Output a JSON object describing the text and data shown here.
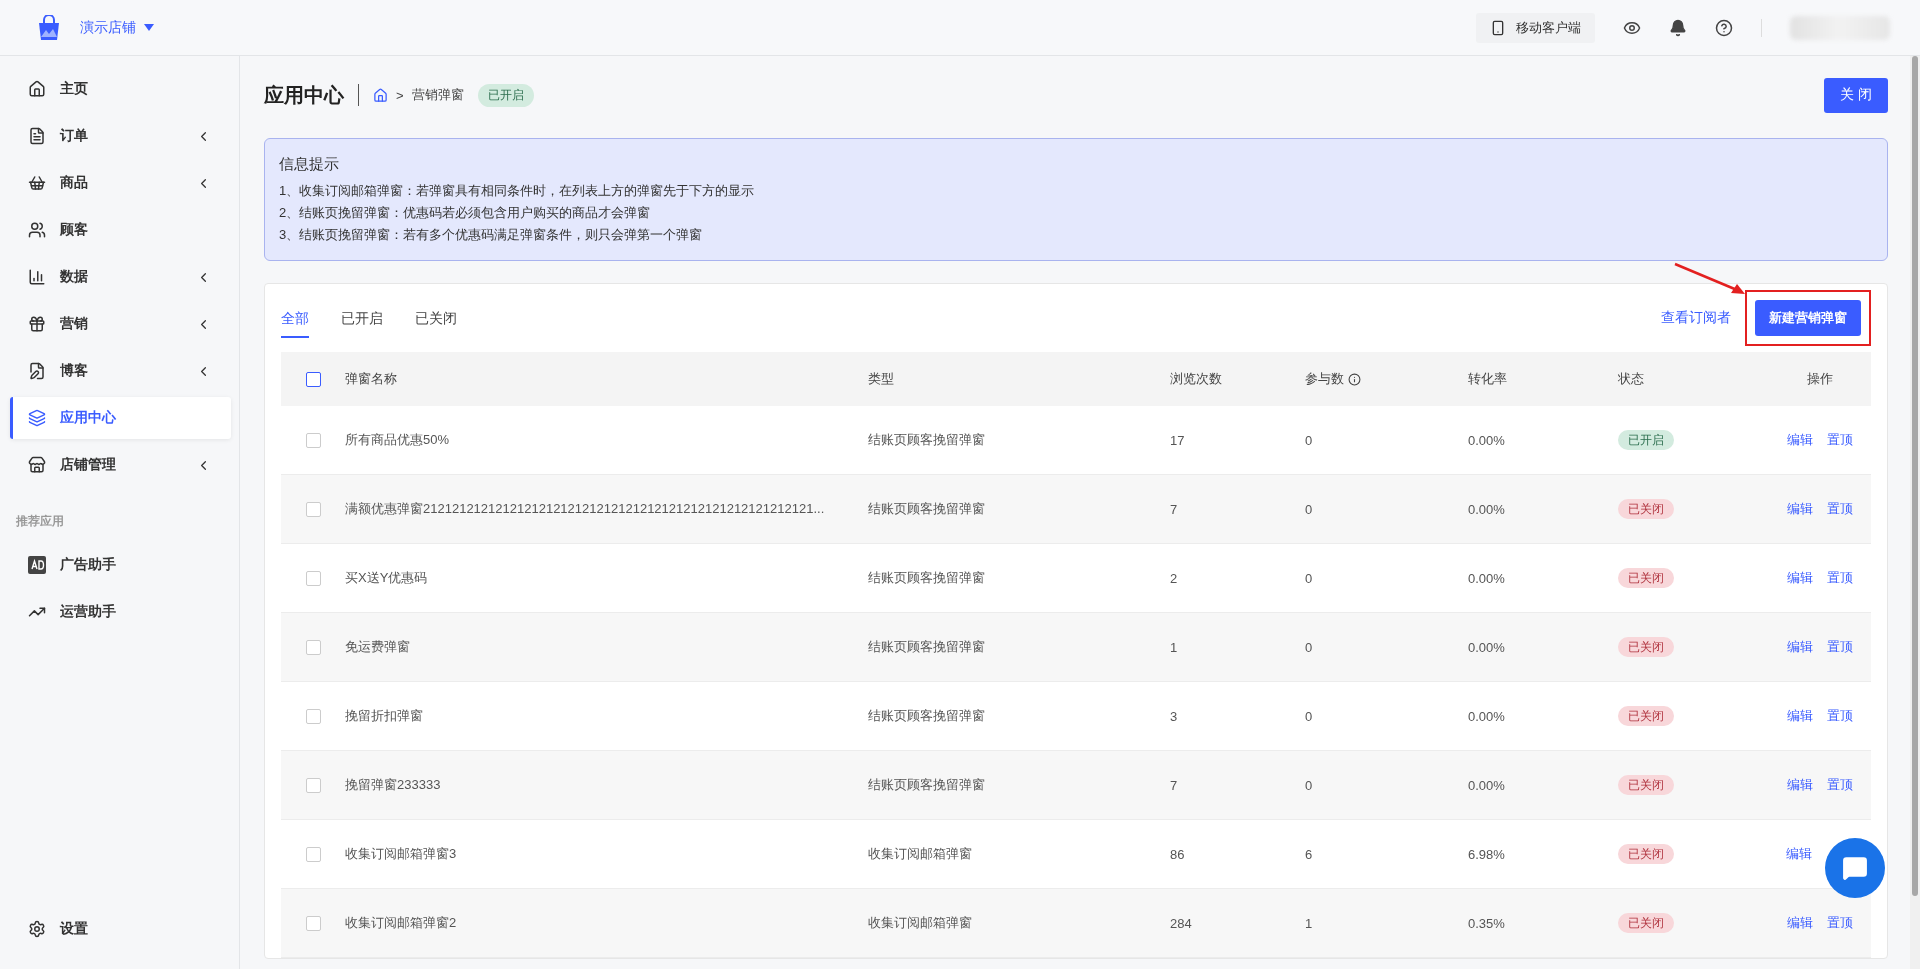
{
  "topbar": {
    "store_name": "演示店铺",
    "mobile_label": "移动客户端"
  },
  "sidebar": {
    "items": [
      {
        "label": "主页",
        "expandable": false,
        "selected": false
      },
      {
        "label": "订单",
        "expandable": true,
        "selected": false
      },
      {
        "label": "商品",
        "expandable": true,
        "selected": false
      },
      {
        "label": "顾客",
        "expandable": false,
        "selected": false
      },
      {
        "label": "数据",
        "expandable": true,
        "selected": false
      },
      {
        "label": "营销",
        "expandable": true,
        "selected": false
      },
      {
        "label": "博客",
        "expandable": true,
        "selected": false
      },
      {
        "label": "应用中心",
        "expandable": false,
        "selected": true
      },
      {
        "label": "店铺管理",
        "expandable": true,
        "selected": false
      }
    ],
    "section_label": "推荐应用",
    "apps": [
      {
        "label": "广告助手"
      },
      {
        "label": "运营助手"
      }
    ],
    "settings": "设置"
  },
  "page": {
    "title": "应用中心",
    "breadcrumb": [
      ">",
      "营销弹窗"
    ],
    "status": {
      "label": "已开启",
      "enabled": true
    },
    "close_button": "关 闭"
  },
  "notice": {
    "title": "信息提示",
    "lines": [
      "1、收集订阅邮箱弹窗：若弹窗具有相同条件时，在列表上方的弹窗先于下方的显示",
      "2、结账页挽留弹窗：优惠码若必须包含用户购买的商品才会弹窗",
      "3、结账页挽留弹窗：若有多个优惠码满足弹窗条件，则只会弹第一个弹窗"
    ]
  },
  "tabs": [
    {
      "label": "全部",
      "selected": true
    },
    {
      "label": "已开启",
      "selected": false
    },
    {
      "label": "已关闭",
      "selected": false
    }
  ],
  "subscribers_link": "查看订阅者",
  "new_button": "新建营销弹窗",
  "table": {
    "header_checked": false,
    "columns": [
      "弹窗名称",
      "类型",
      "浏览次数",
      "参与数",
      "转化率",
      "状态",
      "操作"
    ],
    "rows": [
      {
        "checked": false,
        "name": "所有商品优惠50%",
        "type": "结账页顾客挽留弹窗",
        "views": "17",
        "participants": "0",
        "rate": "0.00%",
        "status": "已开启",
        "enabled": true,
        "actions": [
          "编辑",
          "置顶"
        ]
      },
      {
        "checked": false,
        "name": "满额优惠弹窗212121212121212121212121212121212121212121212121212121...",
        "type": "结账页顾客挽留弹窗",
        "views": "7",
        "participants": "0",
        "rate": "0.00%",
        "status": "已关闭",
        "enabled": false,
        "actions": [
          "编辑",
          "置顶"
        ]
      },
      {
        "checked": false,
        "name": "买X送Y优惠码",
        "type": "结账页顾客挽留弹窗",
        "views": "2",
        "participants": "0",
        "rate": "0.00%",
        "status": "已关闭",
        "enabled": false,
        "actions": [
          "编辑",
          "置顶"
        ]
      },
      {
        "checked": false,
        "name": "免运费弹窗",
        "type": "结账页顾客挽留弹窗",
        "views": "1",
        "participants": "0",
        "rate": "0.00%",
        "status": "已关闭",
        "enabled": false,
        "actions": [
          "编辑",
          "置顶"
        ]
      },
      {
        "checked": false,
        "name": "挽留折扣弹窗",
        "type": "结账页顾客挽留弹窗",
        "views": "3",
        "participants": "0",
        "rate": "0.00%",
        "status": "已关闭",
        "enabled": false,
        "actions": [
          "编辑",
          "置顶"
        ]
      },
      {
        "checked": false,
        "name": "挽留弹窗233333",
        "type": "结账页顾客挽留弹窗",
        "views": "7",
        "participants": "0",
        "rate": "0.00%",
        "status": "已关闭",
        "enabled": false,
        "actions": [
          "编辑",
          "置顶"
        ]
      },
      {
        "checked": false,
        "name": "收集订阅邮箱弹窗3",
        "type": "收集订阅邮箱弹窗",
        "views": "86",
        "participants": "6",
        "rate": "6.98%",
        "status": "已关闭",
        "enabled": false,
        "actions": [
          "编辑"
        ]
      },
      {
        "checked": false,
        "name": "收集订阅邮箱弹窗2",
        "type": "收集订阅邮箱弹窗",
        "views": "284",
        "participants": "1",
        "rate": "0.35%",
        "status": "已关闭",
        "enabled": false,
        "actions": [
          "编辑",
          "置顶"
        ]
      }
    ]
  }
}
